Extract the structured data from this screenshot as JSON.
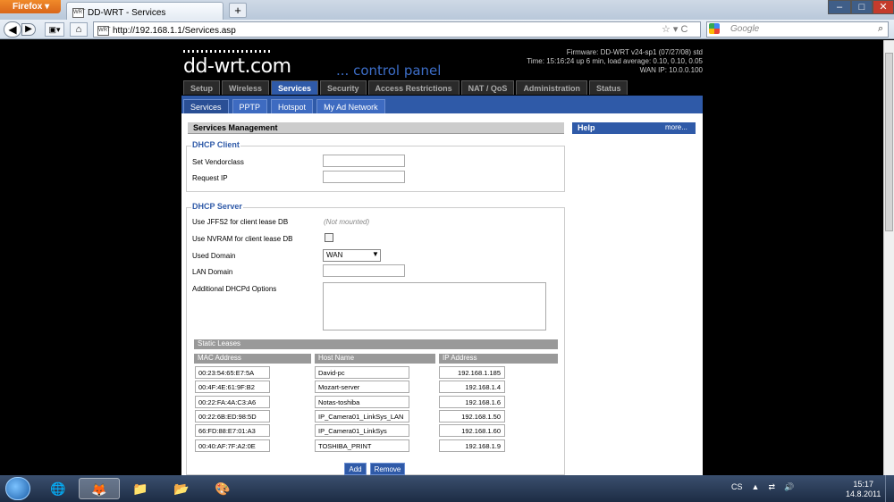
{
  "browser": {
    "app_button": "Firefox",
    "tab_title": "DD-WRT - Services",
    "new_tab": "+",
    "url": "http://192.168.1.1/Services.asp",
    "search_placeholder": "Google"
  },
  "router": {
    "logo": "dd-wrt.com",
    "subtitle": "... control panel",
    "firmware": "Firmware: DD-WRT v24-sp1 (07/27/08) std",
    "time": "Time: 15:16:24 up 6 min, load average: 0.10, 0.10, 0.05",
    "wan_ip": "WAN IP: 10.0.0.100",
    "main_tabs": [
      "Setup",
      "Wireless",
      "Services",
      "Security",
      "Access Restrictions",
      "NAT / QoS",
      "Administration",
      "Status"
    ],
    "active_main_tab": "Services",
    "sub_tabs": [
      "Services",
      "PPTP",
      "Hotspot",
      "My Ad Network"
    ],
    "active_sub_tab": "Services"
  },
  "services": {
    "section_title": "Services Management",
    "help_title": "Help",
    "help_more": "more...",
    "dhcp_client": {
      "legend": "DHCP Client",
      "vendorclass_label": "Set Vendorclass",
      "request_ip_label": "Request IP"
    },
    "dhcp_server": {
      "legend": "DHCP Server",
      "jffs2_label": "Use JFFS2 for client lease DB",
      "jffs2_note": "(Not mounted)",
      "nvram_label": "Use NVRAM for client lease DB",
      "used_domain_label": "Used Domain",
      "used_domain_value": "WAN",
      "lan_domain_label": "LAN Domain",
      "options_label": "Additional DHCPd Options"
    },
    "static_leases": {
      "title": "Static Leases",
      "columns": [
        "MAC Address",
        "Host Name",
        "IP Address"
      ],
      "rows": [
        [
          "00:23:54:65:E7:5A",
          "David-pc",
          "192.168.1.185"
        ],
        [
          "00:4F:4E:61:9F:B2",
          "Mozart-server",
          "192.168.1.4"
        ],
        [
          "00:22:FA:4A:C3:A6",
          "Notas-toshiba",
          "192.168.1.6"
        ],
        [
          "00:22:6B:ED:98:5D",
          "IP_Camera01_LinkSys_LAN",
          "192.168.1.50"
        ],
        [
          "66:FD:88:E7:01:A3",
          "IP_Camera01_LinkSys",
          "192.168.1.60"
        ],
        [
          "00:40:AF:7F:A2:0E",
          "TOSHIBA_PRINT",
          "192.168.1.9"
        ]
      ],
      "add_label": "Add",
      "remove_label": "Remove"
    }
  },
  "taskbar": {
    "language": "CS",
    "time": "15:17",
    "date": "14.8.2011"
  }
}
